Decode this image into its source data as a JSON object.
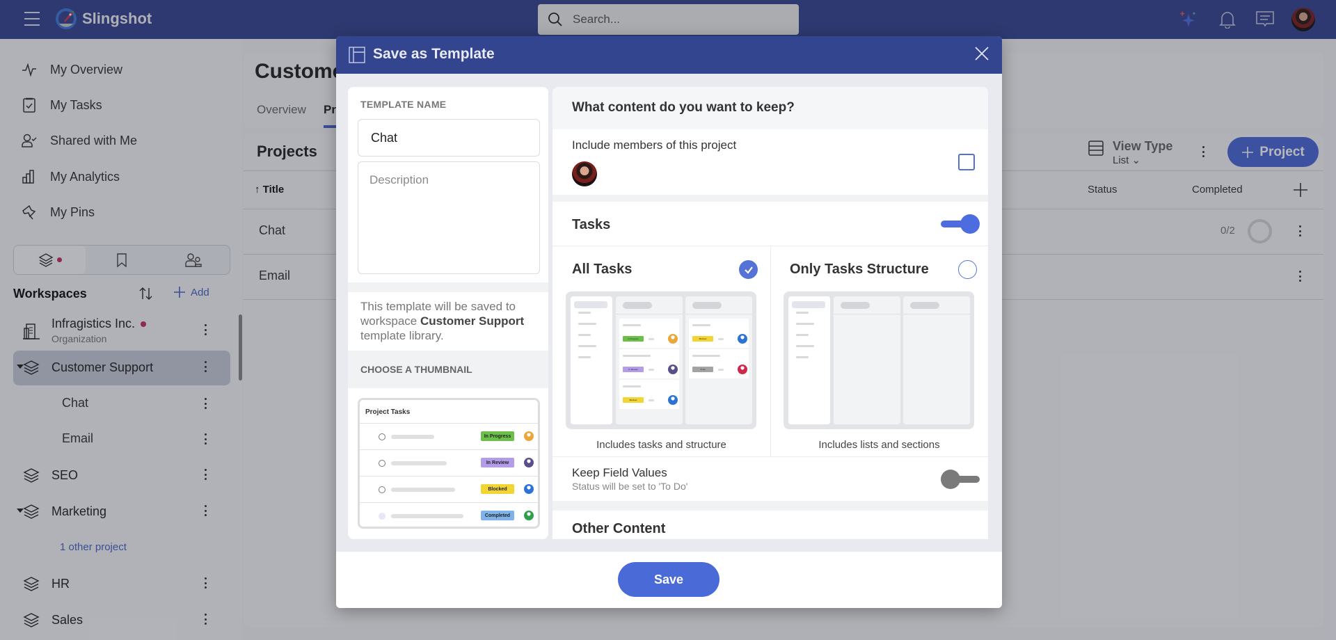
{
  "app": {
    "name": "Slingshot",
    "search_placeholder": "Search...",
    "accent_color": "#4a68d6",
    "header_color": "#34458f"
  },
  "sidebar": {
    "nav": [
      {
        "label": "My Overview",
        "icon": "activity-icon"
      },
      {
        "label": "My Tasks",
        "icon": "clipboard-check-icon"
      },
      {
        "label": "Shared with Me",
        "icon": "user-check-icon"
      },
      {
        "label": "My Analytics",
        "icon": "bar-chart-icon"
      },
      {
        "label": "My Pins",
        "icon": "pin-icon"
      }
    ],
    "segments": [
      "workspaces",
      "bookmarks",
      "people"
    ],
    "workspaces_title": "Workspaces",
    "add_label": "Add",
    "workspaces": [
      {
        "label": "Infragistics Inc.",
        "sub": "Organization",
        "has_dot": true
      },
      {
        "label": "Customer Support",
        "selected": true,
        "expanded": true
      },
      {
        "label": "SEO"
      },
      {
        "label": "Marketing",
        "expanded": true
      },
      {
        "label": "HR"
      },
      {
        "label": "Sales"
      }
    ],
    "customer_support_projects": [
      "Chat",
      "Email"
    ],
    "marketing_other": "1 other project"
  },
  "main": {
    "title": "Custome",
    "tabs": [
      "Overview",
      "Pr"
    ],
    "projects_heading": "Projects",
    "view_type_label": "View Type",
    "view_type_value": "List",
    "add_project_label": "Project",
    "columns": {
      "title": "Title",
      "status": "Status",
      "completed": "Completed"
    },
    "rows": [
      {
        "title": "Chat",
        "completed": "0/2"
      },
      {
        "title": "Email",
        "completed": ""
      }
    ]
  },
  "modal": {
    "title": "Save as Template",
    "template_name_label": "TEMPLATE NAME",
    "template_name_value": "Chat",
    "description_placeholder": "Description",
    "note_prefix": "This template will be saved to workspace ",
    "note_workspace": "Customer Support",
    "note_suffix": " template library.",
    "thumbnail_label": "CHOOSE A THUMBNAIL",
    "thumbnail": {
      "title": "Project Tasks",
      "rows": [
        {
          "tag": "In Progress",
          "color": "#6cc04a",
          "avatar": "#e8a83a",
          "done": false
        },
        {
          "tag": "In Review",
          "color": "#b39ce8",
          "avatar": "#5b4f8a",
          "done": false
        },
        {
          "tag": "Blocked",
          "color": "#f2d533",
          "avatar": "#2d73d6",
          "done": false
        },
        {
          "tag": "Completed",
          "color": "#7fb2e8",
          "avatar": "#2f9e4f",
          "done": true
        }
      ]
    },
    "keep_heading": "What content do you want to keep?",
    "include_members_label": "Include members of this project",
    "include_members_checked": false,
    "tasks_label": "Tasks",
    "tasks_enabled": true,
    "options": [
      {
        "title": "All Tasks",
        "caption": "Includes tasks and structure",
        "selected": true
      },
      {
        "title": "Only Tasks Structure",
        "caption": "Includes lists and sections",
        "selected": false
      }
    ],
    "preview_tags": {
      "col1": [
        {
          "tag": "In Progress",
          "color": "#6cc04a",
          "avatar": "#e8a83a"
        },
        {
          "tag": "In Review",
          "color": "#b39ce8",
          "avatar": "#5b4f8a"
        },
        {
          "tag": "Blocked",
          "color": "#f2d533",
          "avatar": "#2d73d6"
        }
      ],
      "col2": [
        {
          "tag": "Blocked",
          "color": "#f2d533",
          "avatar": "#2d73d6"
        },
        {
          "tag": "To Do",
          "color": "#a3a3a3",
          "avatar": "#d0284b"
        }
      ]
    },
    "keep_field_values_label": "Keep Field Values",
    "keep_field_values_sub": "Status will be set to 'To Do'",
    "keep_field_values_enabled": false,
    "other_content_label": "Other Content",
    "save_label": "Save"
  }
}
